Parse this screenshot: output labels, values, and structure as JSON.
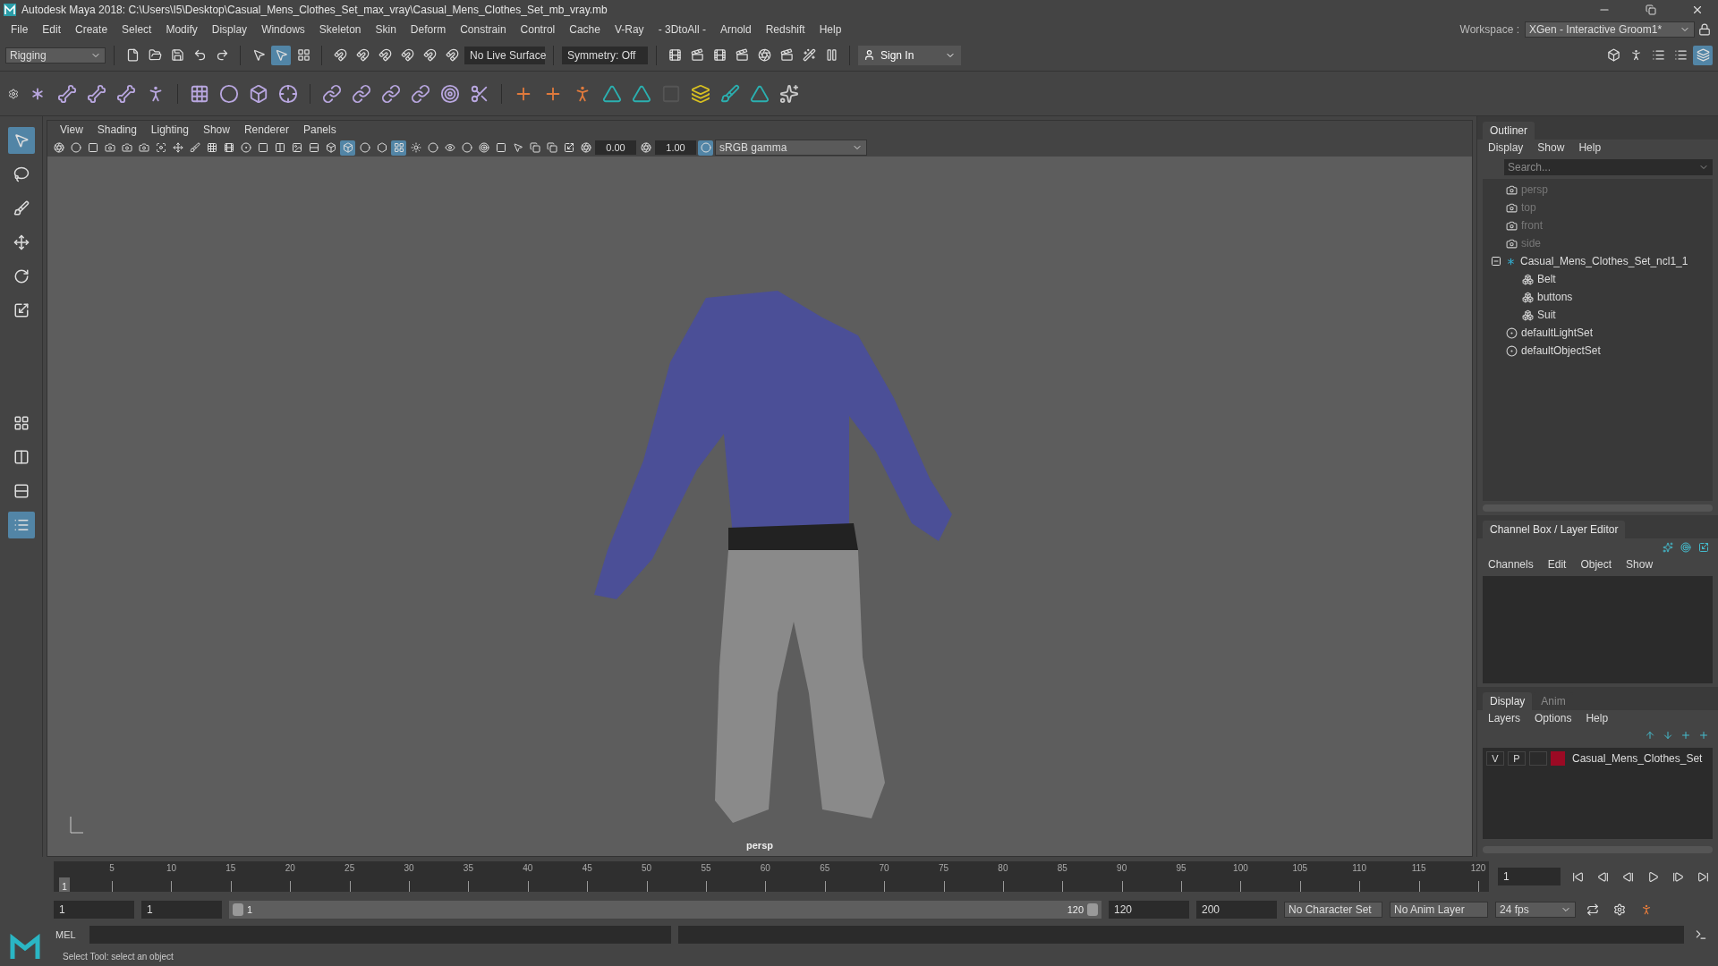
{
  "window": {
    "title": "Autodesk Maya 2018: C:\\Users\\I5\\Desktop\\Casual_Mens_Clothes_Set_max_vray\\Casual_Mens_Clothes_Set_mb_vray.mb"
  },
  "menu_bar": [
    "File",
    "Edit",
    "Create",
    "Select",
    "Modify",
    "Display",
    "Windows",
    "Skeleton",
    "Skin",
    "Deform",
    "Constrain",
    "Control",
    "Cache",
    "V-Ray",
    "- 3DtoAll -",
    "Arnold",
    "Redshift",
    "Help"
  ],
  "workspace": {
    "label": "Workspace :",
    "value": "XGen - Interactive Groom1*"
  },
  "status_line": {
    "menu_set": "Rigging",
    "live_surface": "No Live Surface",
    "symmetry": "Symmetry: Off",
    "sign_in": "Sign In"
  },
  "toolbox": [
    {
      "kind": "select",
      "selected": true
    },
    {
      "kind": "lasso",
      "selected": false
    },
    {
      "kind": "paint",
      "selected": false
    },
    {
      "kind": "move",
      "selected": false
    },
    {
      "kind": "rotate",
      "selected": false
    },
    {
      "kind": "scale",
      "selected": false
    }
  ],
  "viewport": {
    "menus": [
      "View",
      "Shading",
      "Lighting",
      "Show",
      "Renderer",
      "Panels"
    ],
    "exposure": "0.00",
    "gamma": "1.00",
    "color_space": "sRGB gamma",
    "camera": "persp"
  },
  "outliner": {
    "title": "Outliner",
    "menus": [
      "Display",
      "Show",
      "Help"
    ],
    "search": {
      "placeholder": "Search..."
    },
    "items": [
      {
        "label": "persp",
        "kind": "camera",
        "dimmed": true
      },
      {
        "label": "top",
        "kind": "camera",
        "dimmed": true
      },
      {
        "label": "front",
        "kind": "camera",
        "dimmed": true
      },
      {
        "label": "side",
        "kind": "camera",
        "dimmed": true
      },
      {
        "label": "Casual_Mens_Clothes_Set_ncl1_1",
        "kind": "group",
        "dimmed": false,
        "expanded": true,
        "children": [
          {
            "label": "Belt",
            "kind": "mesh",
            "dimmed": false
          },
          {
            "label": "buttons",
            "kind": "mesh",
            "dimmed": false
          },
          {
            "label": "Suit",
            "kind": "mesh",
            "dimmed": false
          }
        ]
      },
      {
        "label": "defaultLightSet",
        "kind": "set",
        "dimmed": false
      },
      {
        "label": "defaultObjectSet",
        "kind": "set",
        "dimmed": false
      }
    ]
  },
  "channel_box": {
    "title": "Channel Box / Layer Editor",
    "menus": [
      "Channels",
      "Edit",
      "Object",
      "Show"
    ]
  },
  "layer_editor": {
    "tabs": [
      {
        "label": "Display",
        "selected": true
      },
      {
        "label": "Anim",
        "selected": false
      }
    ],
    "menus": [
      "Layers",
      "Options",
      "Help"
    ],
    "layers": [
      {
        "visible": "V",
        "playback": "P",
        "name": "Casual_Mens_Clothes_Set",
        "color": "#9b0a24"
      }
    ]
  },
  "timeline": {
    "start": "1",
    "ticks": [
      "5",
      "10",
      "15",
      "20",
      "25",
      "30",
      "35",
      "40",
      "45",
      "50",
      "55",
      "60",
      "65",
      "70",
      "75",
      "80",
      "85",
      "90",
      "95",
      "100",
      "105",
      "110",
      "115",
      "120"
    ],
    "current_frame": "1"
  },
  "range": {
    "start": "1",
    "playback_start": "1",
    "slider_start": "1",
    "slider_end": "120",
    "level": 1,
    "playback_end": "120",
    "end": "200",
    "character_set": "No Character Set",
    "anim_layer": "No Anim Layer",
    "fps": "24 fps"
  },
  "command_line": {
    "label": "MEL"
  },
  "help_line": "Select Tool: select an object"
}
